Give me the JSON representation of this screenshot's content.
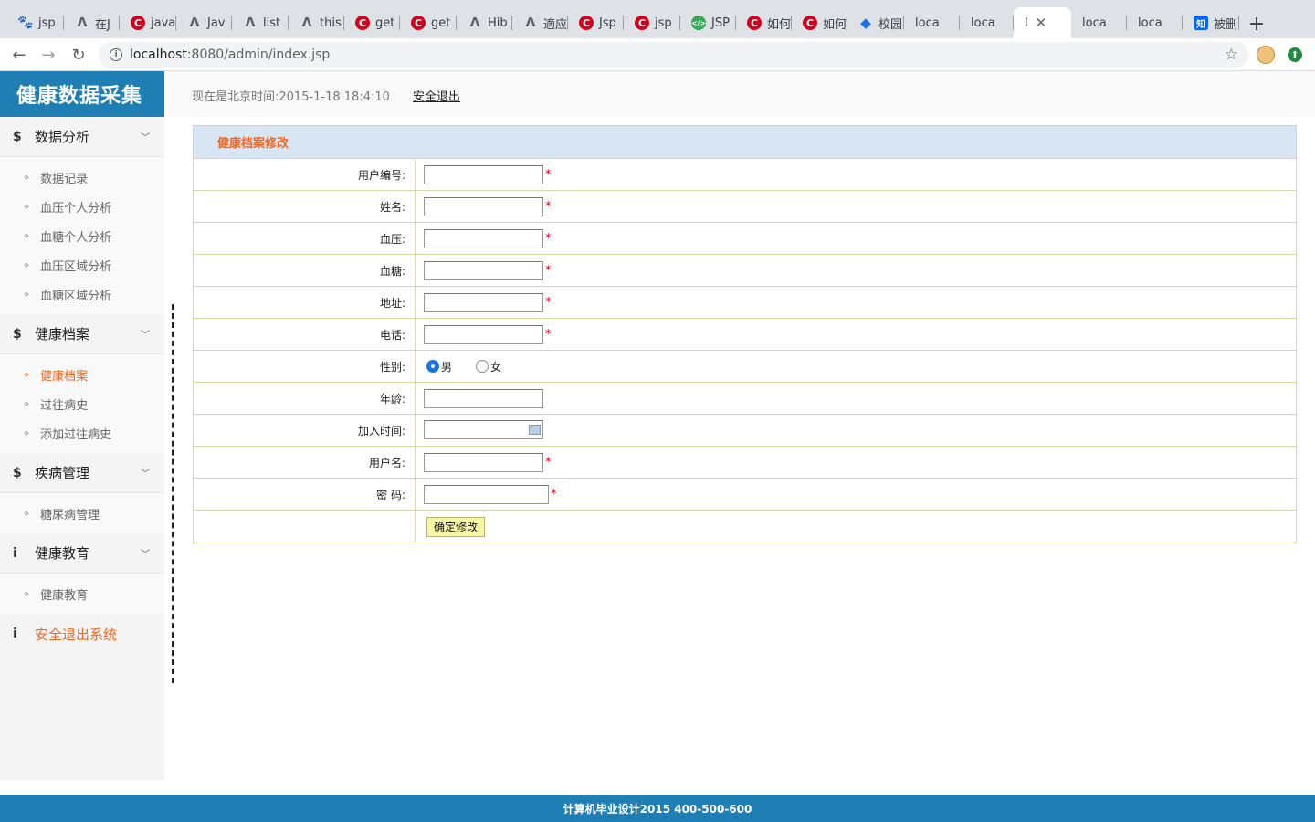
{
  "browser": {
    "tabs": [
      {
        "title": "jsp",
        "icon": "paw-icon"
      },
      {
        "title": "在J",
        "icon": "feather-icon"
      },
      {
        "title": "java",
        "icon": "csdn-icon"
      },
      {
        "title": "Jav",
        "icon": "feather-icon"
      },
      {
        "title": "list",
        "icon": "feather-icon"
      },
      {
        "title": "this",
        "icon": "feather-icon"
      },
      {
        "title": "get",
        "icon": "chrome-icon"
      },
      {
        "title": "get",
        "icon": "csdn-icon"
      },
      {
        "title": "Hib",
        "icon": "feather-icon"
      },
      {
        "title": "適应",
        "icon": "feather-icon"
      },
      {
        "title": "Jsp",
        "icon": "csdn-icon"
      },
      {
        "title": "jsp",
        "icon": "csdn-icon"
      },
      {
        "title": "JSP",
        "icon": "code-icon"
      },
      {
        "title": "如何",
        "icon": "csdn-icon"
      },
      {
        "title": "如何",
        "icon": "csdn-icon"
      },
      {
        "title": "校园",
        "icon": "diamond-icon"
      },
      {
        "title": "loca",
        "icon": "page-icon"
      },
      {
        "title": "loca",
        "icon": "page-icon"
      },
      {
        "title": "l",
        "icon": "page-icon",
        "active": true
      },
      {
        "title": "loca",
        "icon": "page-icon"
      },
      {
        "title": "loca",
        "icon": "page-icon"
      },
      {
        "title": "被删",
        "icon": "zhihu-icon"
      }
    ],
    "url_host": "localhost",
    "url_path": ":8080/admin/index.jsp"
  },
  "header": {
    "logo": "健康数据采集",
    "clock": "现在是北京时间:2015-1-18 18:4:10",
    "logout": "安全退出"
  },
  "sidebar": {
    "groups": [
      {
        "icon": "$",
        "label": "数据分析",
        "items": [
          "数据记录",
          "血压个人分析",
          "血糖个人分析",
          "血压区域分析",
          "血糖区域分析"
        ]
      },
      {
        "icon": "$",
        "label": "健康档案",
        "items": [
          "健康档案",
          "过往病史",
          "添加过往病史"
        ],
        "active_item": 0
      },
      {
        "icon": "$",
        "label": "疾病管理",
        "items": [
          "糖尿病管理"
        ]
      },
      {
        "icon": "i",
        "label": "健康教育",
        "items": [
          "健康教育"
        ]
      }
    ],
    "exit_label": "安全退出系统"
  },
  "form": {
    "title": "健康档案修改",
    "fields": {
      "user_id": {
        "label": "用户编号:",
        "value": ""
      },
      "name": {
        "label": "姓名:",
        "value": ""
      },
      "blood_pressure": {
        "label": "血压:",
        "value": ""
      },
      "blood_sugar": {
        "label": "血糖:",
        "value": ""
      },
      "address": {
        "label": "地址:",
        "value": ""
      },
      "phone": {
        "label": "电话:",
        "value": ""
      },
      "gender": {
        "label": "性别:",
        "options": [
          "男",
          "女"
        ],
        "selected": "男"
      },
      "age": {
        "label": "年龄:",
        "value": ""
      },
      "join_time": {
        "label": "加入时间:",
        "value": ""
      },
      "username": {
        "label": "用户名:",
        "value": ""
      },
      "password": {
        "label": "密 码:",
        "value": ""
      }
    },
    "required_mark": "*",
    "submit_label": "确定修改"
  },
  "footer": {
    "text": "计算机毕业设计2015  400-500-600"
  },
  "colors": {
    "brand_blue": "#1f7fb4",
    "accent_orange": "#f26522",
    "form_header_bg": "#d8e5f2",
    "form_border": "#cfdca6",
    "button_bg": "#f7f7a8"
  }
}
